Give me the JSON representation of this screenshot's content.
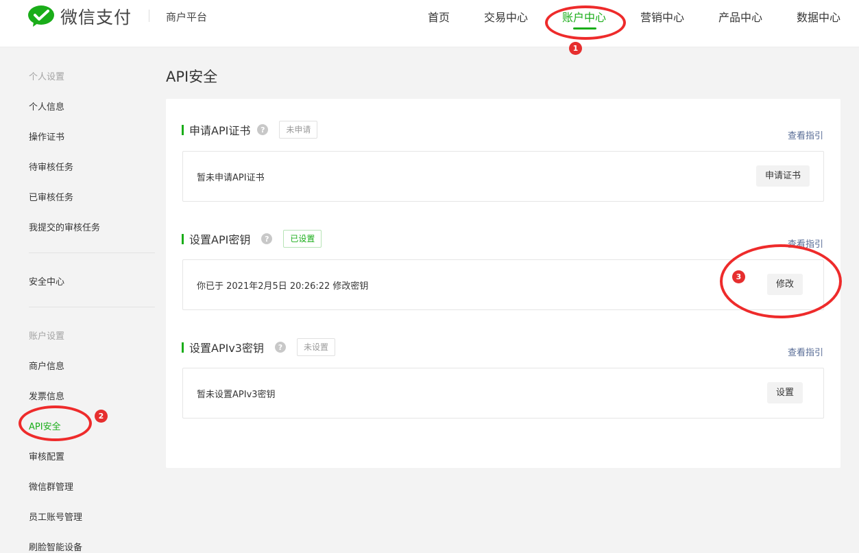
{
  "header": {
    "logo_text": "微信支付",
    "platform": "商户平台",
    "nav": [
      "首页",
      "交易中心",
      "账户中心",
      "营销中心",
      "产品中心",
      "数据中心"
    ],
    "active_nav": "账户中心"
  },
  "sidebar": {
    "group_personal": "个人设置",
    "personal_items": [
      "个人信息",
      "操作证书",
      "待审核任务",
      "已审核任务",
      "我提交的审核任务"
    ],
    "security_center": "安全中心",
    "group_account": "账户设置",
    "account_items": [
      "商户信息",
      "发票信息",
      "API安全",
      "审核配置",
      "微信群管理",
      "员工账号管理",
      "刷脸智能设备"
    ],
    "active_item": "API安全"
  },
  "main": {
    "title": "API安全",
    "sections": [
      {
        "title": "申请API证书",
        "help": "?",
        "status": "未申请",
        "guide": "查看指引",
        "text": "暂未申请API证书",
        "button": "申请证书"
      },
      {
        "title": "设置API密钥",
        "help": "?",
        "status": "已设置",
        "guide": "查看指引",
        "text": "你已于 2021年2月5日 20:26:22 修改密钥",
        "button": "修改"
      },
      {
        "title": "设置APIv3密钥",
        "help": "?",
        "status": "未设置",
        "guide": "查看指引",
        "text": "暂未设置APIv3密钥",
        "button": "设置"
      }
    ]
  },
  "annotations": [
    "1",
    "2",
    "3"
  ],
  "colors": {
    "accent": "#1aad19",
    "link": "#576b95",
    "annotation": "#ee2b2b"
  }
}
